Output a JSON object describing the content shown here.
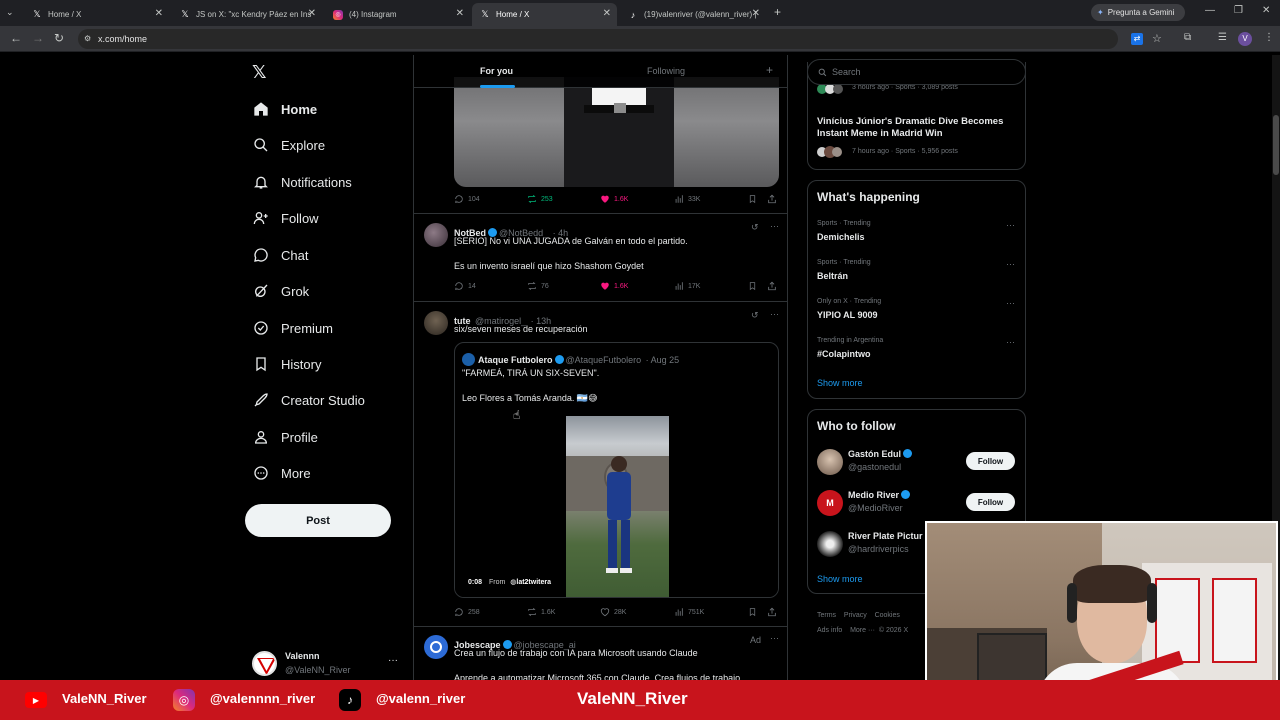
{
  "browser": {
    "tabs": [
      {
        "label": "Home / X"
      },
      {
        "label": "JS on X: \"xc Kendry Páez en Ins"
      },
      {
        "label": "(4) Instagram"
      },
      {
        "label": "Home / X"
      },
      {
        "label": "(19)valenriver (@valenn_river) |"
      }
    ],
    "gemini_label": "Pregunta a Gemini",
    "url": "x.com/home",
    "profile_initial": "V"
  },
  "nav": {
    "items": [
      {
        "label": "Home"
      },
      {
        "label": "Explore"
      },
      {
        "label": "Notifications"
      },
      {
        "label": "Follow"
      },
      {
        "label": "Chat"
      },
      {
        "label": "Grok"
      },
      {
        "label": "Premium"
      },
      {
        "label": "History"
      },
      {
        "label": "Creator Studio"
      },
      {
        "label": "Profile"
      },
      {
        "label": "More"
      }
    ],
    "post_label": "Post",
    "account": {
      "name": "Valennn",
      "handle": "@ValeNN_River"
    }
  },
  "feed": {
    "tabs": [
      {
        "label": "For you"
      },
      {
        "label": "Following"
      }
    ],
    "post0": {
      "replies": "104",
      "reposts": "253",
      "likes": "1.6K",
      "views": "33K"
    },
    "post1": {
      "name": "NotBed",
      "handle": "@NotBedd_",
      "time": "· 4h",
      "line1": "[SERIO] No vi UNA JUGADA de Galván en todo el partido.",
      "line2": "Es un invento israelí que hizo Shashom Goydet",
      "replies": "14",
      "reposts": "76",
      "likes": "1.6K",
      "views": "17K"
    },
    "post2": {
      "name": "tute",
      "handle": "@matirogel_",
      "time": "· 13h",
      "text": "six/seven meses de recuperación",
      "quote": {
        "name": "Ataque Futbolero",
        "handle": "@AtaqueFutbolero",
        "date": "· Aug 25",
        "line1": "\"FARMEÁ, TIRÁ UN SIX-SEVEN\".",
        "line2": "Leo Flores a Tomás Aranda. 🇦🇷😅",
        "video_time": "0:08",
        "from_label": "From",
        "from_handle": "lat2twitera"
      },
      "replies": "258",
      "reposts": "1.6K",
      "likes": "28K",
      "views": "751K"
    },
    "post3": {
      "name": "Jobescape",
      "handle": "@jobescape_ai",
      "ad": "Ad",
      "text": "Crea un flujo de trabajo con IA para Microsoft usando Claude",
      "text2": "Aprende a automatizar Microsoft 365 con Claude. Crea flujos de trabajo"
    }
  },
  "right": {
    "search_placeholder": "Search",
    "top_card": {
      "meta1": "3 hours ago · Sports · 3,089 posts",
      "headline": "Vinícius Júnior's Dramatic Dive Becomes Instant Meme in Madrid Win",
      "meta2": "7 hours ago · Sports · 5,956 posts"
    },
    "happening": {
      "title": "What's happening",
      "trends": [
        {
          "context": "Sports · Trending",
          "name": "Demichelis"
        },
        {
          "context": "Sports · Trending",
          "name": "Beltrán"
        },
        {
          "context": "Only on X · Trending",
          "name": "YIPIO AL 9009"
        },
        {
          "context": "Trending in Argentina",
          "name": "#Colapintwo"
        }
      ],
      "show_more": "Show more"
    },
    "who_to_follow": {
      "title": "Who to follow",
      "accounts": [
        {
          "name": "Gastón Edul",
          "handle": "@gastonedul",
          "button": "Follow"
        },
        {
          "name": "Medio River",
          "handle": "@MedioRiver",
          "button": "Follow"
        },
        {
          "name": "River Plate Pictur",
          "handle": "@hardriverpics"
        }
      ],
      "show_more": "Show more"
    },
    "footer": {
      "links": [
        "Terms",
        "Privacy",
        "Cookies",
        "Ads info",
        "More ···",
        "© 2026 X"
      ]
    }
  },
  "banner": {
    "youtube": "ValeNN_River",
    "instagram": "@valennnn_river",
    "tiktok": "@valenn_river",
    "center": "ValeNN_River"
  },
  "colors": {
    "accent": "#1d9bf0",
    "like": "#f91880",
    "repost": "#00ba7c",
    "banner": "#c8141c"
  }
}
